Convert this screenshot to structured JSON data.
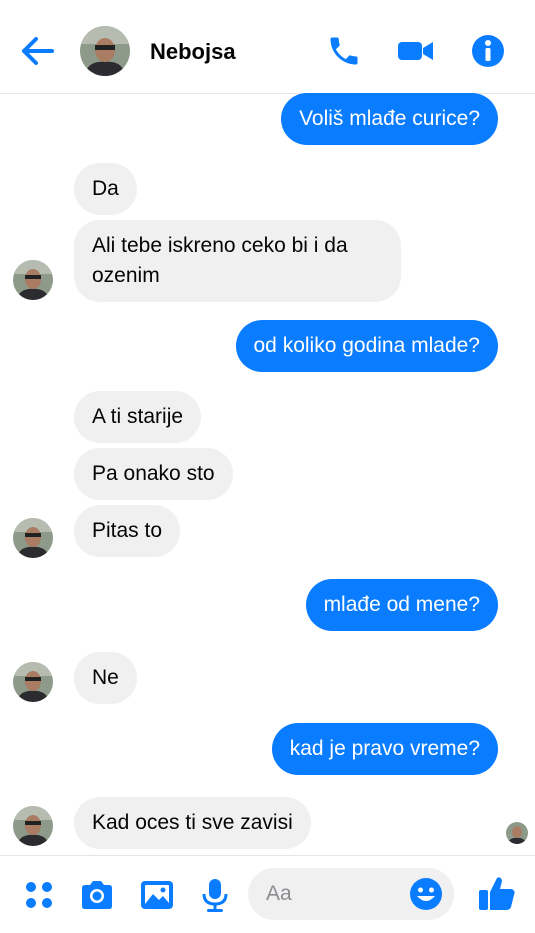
{
  "header": {
    "contact_name": "Nebojsa",
    "icons": [
      "back-arrow-icon",
      "phone-icon",
      "video-camera-icon",
      "info-icon"
    ]
  },
  "messages": [
    {
      "from": "me",
      "text": "Voliš mlađe curice?"
    },
    {
      "from": "them",
      "text": "Da"
    },
    {
      "from": "them",
      "text": "Ali tebe iskreno ceko bi i da ozenim"
    },
    {
      "from": "me",
      "text": "od koliko godina mlade?"
    },
    {
      "from": "them",
      "text": "A ti starije"
    },
    {
      "from": "them",
      "text": "Pa onako sto"
    },
    {
      "from": "them",
      "text": "Pitas to"
    },
    {
      "from": "me",
      "text": "mlađe od mene?"
    },
    {
      "from": "them",
      "text": "Ne"
    },
    {
      "from": "me",
      "text": "kad je pravo vreme?"
    },
    {
      "from": "them",
      "text": "Kad oces ti sve zavisi"
    }
  ],
  "composer": {
    "placeholder": "Aa",
    "icons": [
      "apps-grid-icon",
      "camera-icon",
      "gallery-icon",
      "microphone-icon",
      "emoji-icon",
      "thumbs-up-icon"
    ]
  },
  "colors": {
    "accent": "#0a7cff",
    "incoming_bubble": "#f0f0f0",
    "outgoing_text": "#ffffff"
  }
}
